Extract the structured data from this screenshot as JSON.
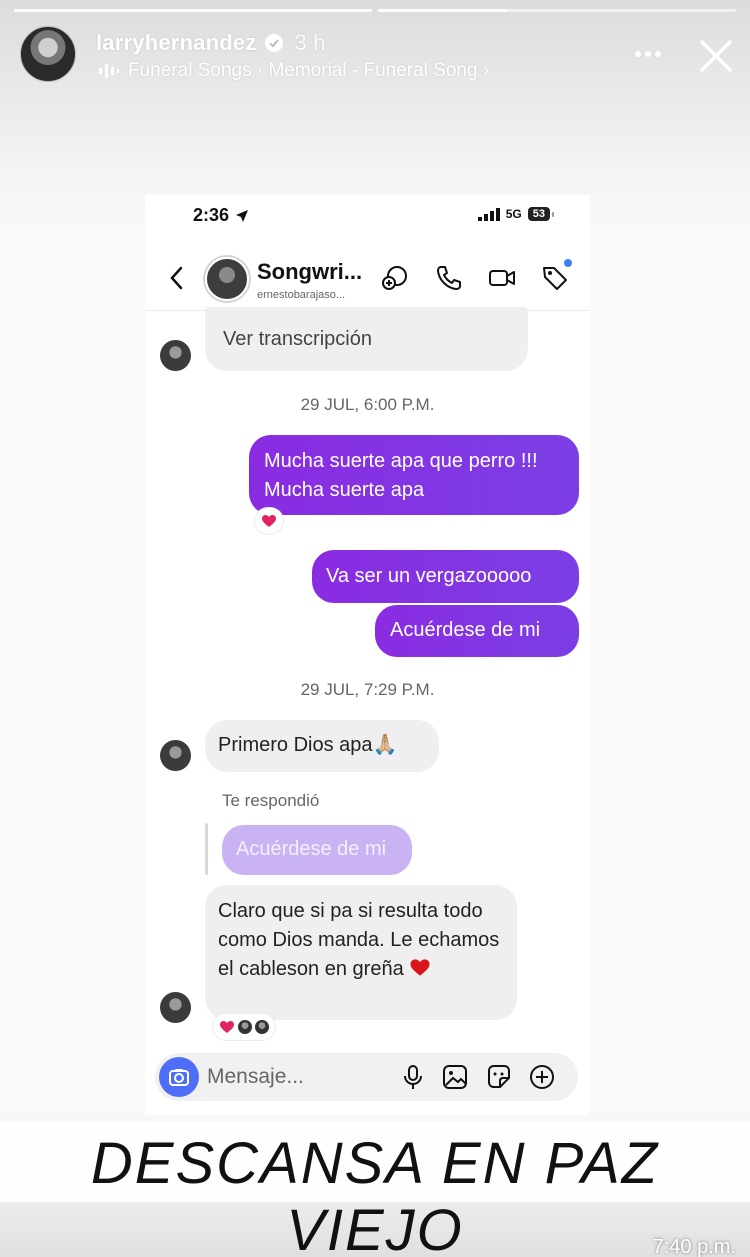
{
  "story": {
    "username": "larryhernandez",
    "time_ago": "3 h",
    "song": "Funeral Songs · Memorial - Funeral Song ›",
    "caption": "DESCANSA EN PAZ VIEJO",
    "bottom_time": "7:40 p.m.",
    "progress": [
      1.0,
      0.36
    ]
  },
  "status_bar": {
    "time": "2:36",
    "network": "5G",
    "battery": "53"
  },
  "chat_header": {
    "name": "Songwri...",
    "handle": "ernestobarajaso..."
  },
  "messages": {
    "voice_transcript": "Ver transcripción",
    "timestamp_1": "29 JUL, 6:00 P.M.",
    "out_1": "Mucha suerte apa que perro !!! Mucha suerte apa",
    "out_2": "Va ser un vergazooooo",
    "out_3": "Acuérdese de mi",
    "timestamp_2": "29 JUL, 7:29 P.M.",
    "in_1": "Primero Dios apa🙏🏼",
    "reply_label": "Te respondió",
    "reply_quote": "Acuérdese de mi",
    "in_2": "Claro que si pa si resulta todo como Dios manda. Le echamos el cableson en greña"
  },
  "composer": {
    "placeholder": "Mensaje..."
  },
  "colors": {
    "outgoing": "#8a2be2",
    "incoming": "#efefef",
    "accent": "#4f6ef7",
    "heart": "#e0245e"
  },
  "icons": [
    "verified-badge-icon",
    "music-bars-icon",
    "more-dots-icon",
    "close-icon",
    "location-arrow-icon",
    "signal-icon",
    "back-chevron-icon",
    "add-friend-icon",
    "phone-icon",
    "video-icon",
    "tag-icon",
    "camera-icon",
    "mic-icon",
    "image-icon",
    "sticker-icon",
    "plus-circle-icon",
    "heart-icon"
  ]
}
